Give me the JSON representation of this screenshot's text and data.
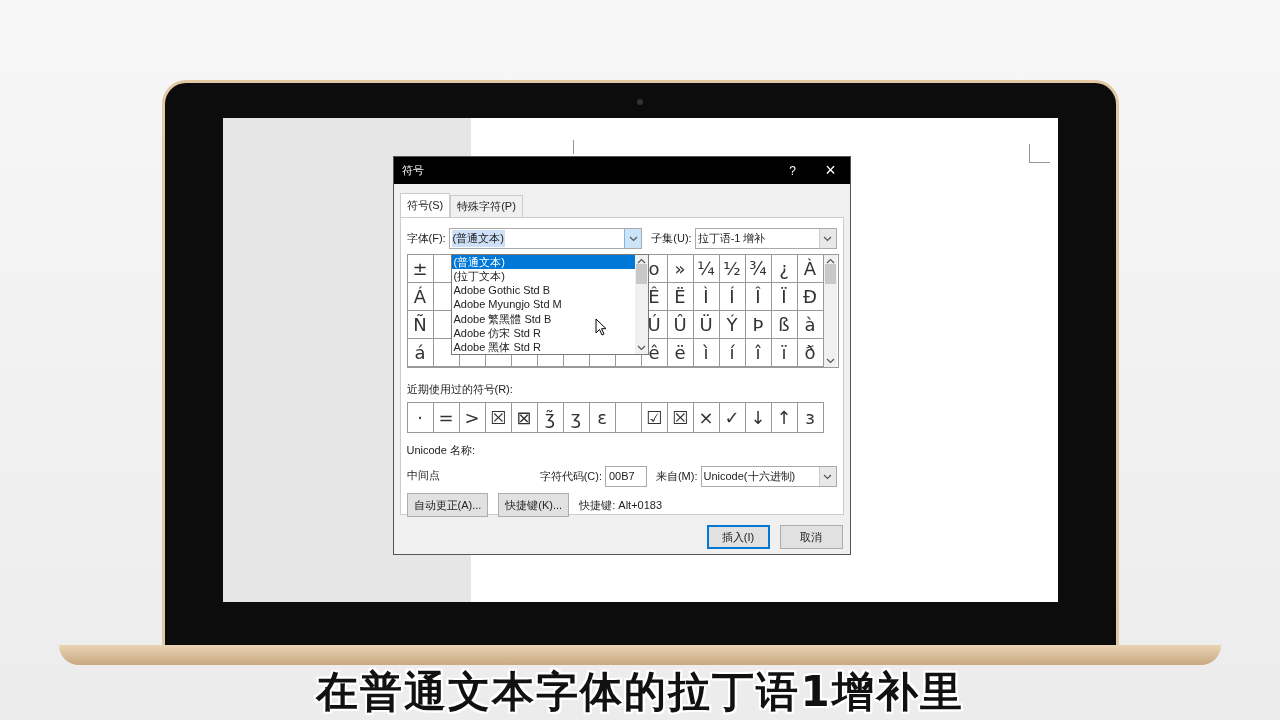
{
  "dialog": {
    "title": "符号",
    "help": "?",
    "close": "×",
    "tabs": [
      {
        "label": "符号(S)",
        "selected": true
      },
      {
        "label": "特殊字符(P)",
        "selected": false
      }
    ],
    "font_label": "字体(F):",
    "font_value": "(普通文本)",
    "subset_label": "子集(U):",
    "subset_value": "拉丁语-1 增补",
    "font_dropdown": {
      "items": [
        {
          "label": "(普通文本)",
          "selected": true
        },
        {
          "label": "(拉丁文本)",
          "selected": false
        },
        {
          "label": "Adobe Gothic Std B",
          "selected": false
        },
        {
          "label": "Adobe Myungjo Std M",
          "selected": false
        },
        {
          "label": "Adobe 繁黑體 Std B",
          "selected": false
        },
        {
          "label": "Adobe 仿宋 Std R",
          "selected": false
        },
        {
          "label": "Adobe 黑体 Std R",
          "selected": false
        }
      ]
    },
    "symbol_grid": {
      "rows": [
        {
          "left": [
            "±"
          ],
          "right": [
            "o",
            "»",
            "¼",
            "½",
            "¾",
            "¿",
            "À"
          ]
        },
        {
          "left": [
            "Á"
          ],
          "right": [
            "Ê",
            "Ë",
            "Ì",
            "Í",
            "Î",
            "Ï",
            "Ð"
          ]
        },
        {
          "left": [
            "Ñ"
          ],
          "right": [
            "Ú",
            "Û",
            "Ü",
            "Ý",
            "Þ",
            "ß",
            "à"
          ]
        },
        {
          "left": [
            "á"
          ],
          "right": [
            "ê",
            "ë",
            "ì",
            "í",
            "î",
            "ï",
            "ð"
          ]
        }
      ]
    },
    "recent_label": "近期使用过的符号(R):",
    "recent": [
      {
        "kind": "char",
        "char": "·"
      },
      {
        "kind": "char",
        "char": "="
      },
      {
        "kind": "char",
        "char": ">"
      },
      {
        "kind": "char",
        "char": "☒"
      },
      {
        "kind": "char",
        "char": "⊠"
      },
      {
        "kind": "char",
        "char": "ʒ̃"
      },
      {
        "kind": "char",
        "char": "ʒ"
      },
      {
        "kind": "char",
        "char": "ε"
      },
      {
        "kind": "blank"
      },
      {
        "kind": "char",
        "char": "☑"
      },
      {
        "kind": "char",
        "char": "☒"
      },
      {
        "kind": "char",
        "char": "×"
      },
      {
        "kind": "char",
        "char": "✓"
      },
      {
        "kind": "char",
        "char": "↓"
      },
      {
        "kind": "char",
        "char": "↑"
      },
      {
        "kind": "char",
        "char": "з"
      }
    ],
    "unicode_name_label": "Unicode 名称:",
    "unicode_name": "中间点",
    "char_code_label": "字符代码(C):",
    "char_code": "00B7",
    "from_label": "来自(M):",
    "from_value": "Unicode(十六进制)",
    "autocorrect_button": "自动更正(A)...",
    "shortcut_button": "快捷键(K)...",
    "shortcut_text": "快捷键: Alt+0183",
    "insert_button": "插入(I)",
    "cancel_button": "取消"
  },
  "subtitle": "在普通文本字体的拉丁语1增补里"
}
